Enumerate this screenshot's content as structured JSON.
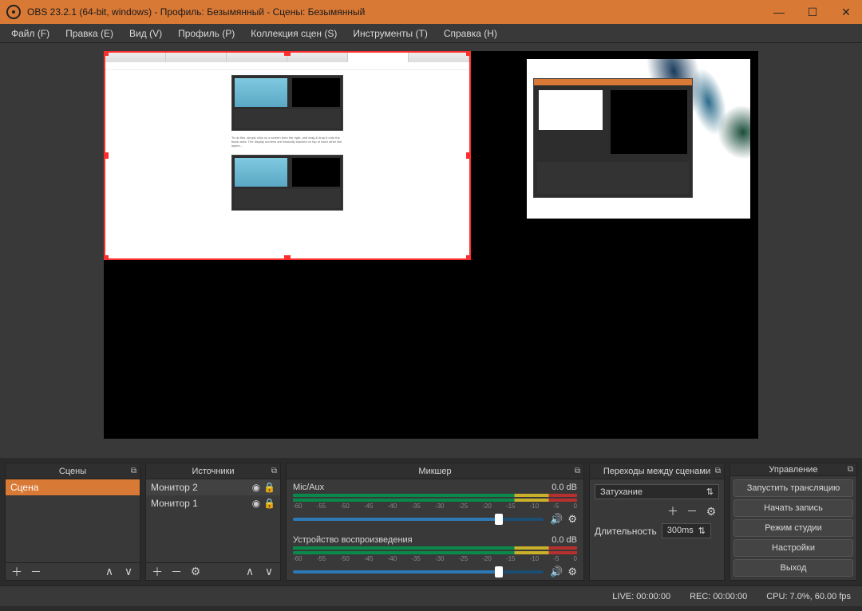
{
  "titlebar": {
    "title": "OBS 23.2.1 (64-bit, windows) - Профиль: Безымянный - Сцены: Безымянный"
  },
  "menu": {
    "file": "Файл (F)",
    "edit": "Правка (E)",
    "view": "Вид (V)",
    "profile": "Профиль (P)",
    "scene_collection": "Коллекция сцен (S)",
    "tools": "Инструменты (T)",
    "help": "Справка (H)"
  },
  "panels": {
    "scenes": "Сцены",
    "sources": "Источники",
    "mixer": "Микшер",
    "transitions": "Переходы между сценами",
    "controls": "Управление"
  },
  "scenes": {
    "items": [
      "Сцена"
    ]
  },
  "sources": {
    "items": [
      "Монитор 2",
      "Монитор 1"
    ]
  },
  "mixer": {
    "ch1_name": "Mic/Aux",
    "ch1_db": "0.0 dB",
    "ch2_name": "Устройство воспроизведения",
    "ch2_db": "0.0 dB",
    "ticks": [
      "-60",
      "-55",
      "-50",
      "-45",
      "-40",
      "-35",
      "-30",
      "-25",
      "-20",
      "-15",
      "-10",
      "-5",
      "0"
    ]
  },
  "transitions": {
    "selected": "Затухание",
    "duration_label": "Длительность",
    "duration_value": "300ms"
  },
  "controls": {
    "start_stream": "Запустить трансляцию",
    "start_record": "Начать запись",
    "studio_mode": "Режим студии",
    "settings": "Настройки",
    "exit": "Выход"
  },
  "status": {
    "live": "LIVE: 00:00:00",
    "rec": "REC: 00:00:00",
    "cpu": "CPU: 7.0%, 60.00 fps"
  }
}
